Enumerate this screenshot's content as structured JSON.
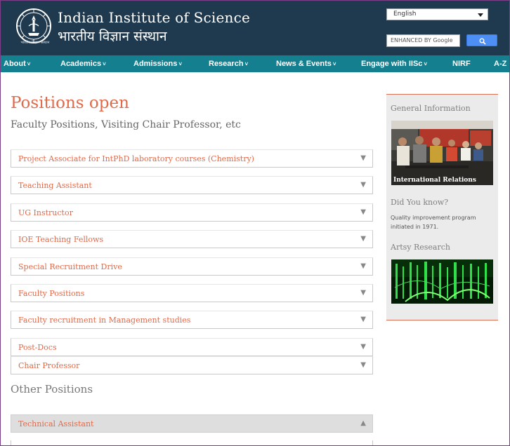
{
  "header": {
    "institute_name": "Indian Institute of Science",
    "institute_name_hindi": "भारतीय विज्ञान संस्थान",
    "logo_caption": "भारतीय विज्ञान संस्थान",
    "language": {
      "selected": "English"
    },
    "search": {
      "placeholder": "ENHANCED BY Google",
      "button_icon": "search-icon"
    }
  },
  "nav": {
    "items": [
      {
        "label": "About",
        "has_dropdown": true
      },
      {
        "label": "Academics",
        "has_dropdown": true
      },
      {
        "label": "Admissions",
        "has_dropdown": true
      },
      {
        "label": "Research",
        "has_dropdown": true
      },
      {
        "label": "News & Events",
        "has_dropdown": true
      },
      {
        "label": "Engage with IISc",
        "has_dropdown": true
      },
      {
        "label": "NIRF",
        "has_dropdown": false
      },
      {
        "label": "A-Z",
        "has_dropdown": false
      }
    ]
  },
  "main": {
    "title": "Positions open",
    "subtitle": "Faculty Positions, Visiting Chair Professor, etc",
    "positions": [
      "Project Associate for IntPhD laboratory courses (Chemistry)",
      "Teaching Assistant",
      "UG Instructor",
      "IOE Teaching Fellows",
      "Special Recruitment Drive",
      "Faculty Positions",
      "Faculty recruitment in Management studies",
      "Post-Docs",
      "Chair Professor"
    ],
    "collapsed_arrow": "▼",
    "expanded_arrow": "▲",
    "other_heading": "Other Positions",
    "other_positions": [
      "Technical Assistant"
    ]
  },
  "sidebar": {
    "general_heading": "General Information",
    "image_caption": "International Relations",
    "did_you_know_heading": "Did You know?",
    "did_you_know_text": "Quality improvement program initiated in 1971.",
    "artsy_heading": "Artsy Research"
  },
  "colors": {
    "header_bg": "#1f3a4e",
    "nav_bg": "#137f8f",
    "accent": "#e06a4a",
    "sidebar_bg": "#ebebeb"
  }
}
